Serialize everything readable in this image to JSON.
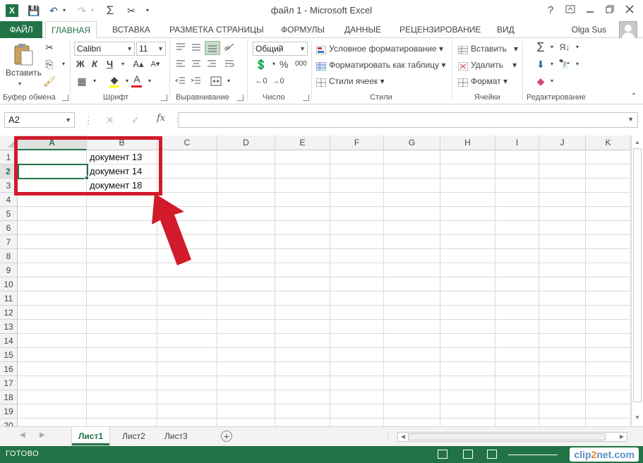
{
  "title_bar": {
    "app_badge": "X",
    "title": "файл 1 - Microsoft Excel",
    "help": "?",
    "qat": {
      "save": "💾",
      "undo": "↶",
      "redo": "↷",
      "autosum": "Σ",
      "cut": "✂"
    }
  },
  "tabs": {
    "file": "ФАЙЛ",
    "items": [
      "ГЛАВНАЯ",
      "ВСТАВКА",
      "РАЗМЕТКА СТРАНИЦЫ",
      "ФОРМУЛЫ",
      "ДАННЫЕ",
      "РЕЦЕНЗИРОВАНИЕ",
      "ВИД"
    ],
    "active": "ГЛАВНАЯ",
    "user": "Olga Sus"
  },
  "ribbon": {
    "clipboard": {
      "paste": "Вставить",
      "label": "Буфер обмена"
    },
    "font": {
      "name": "Calibri",
      "size": "11",
      "bold": "Ж",
      "italic": "К",
      "underline": "Ч",
      "font_color_glyph": "А",
      "label": "Шрифт"
    },
    "alignment": {
      "label": "Выравнивание"
    },
    "number": {
      "format": "Общий",
      "percent": "%",
      "thousands": "000",
      "label": "Число"
    },
    "styles": {
      "conditional": "Условное форматирование",
      "as_table": "Форматировать как таблицу",
      "cell_styles": "Стили ячеек",
      "label": "Стили"
    },
    "cells": {
      "insert": "Вставить",
      "delete": "Удалить",
      "format": "Формат",
      "label": "Ячейки"
    },
    "editing": {
      "label": "Редактирование"
    }
  },
  "formula_bar": {
    "name_box": "A2",
    "fx": "fx",
    "value": ""
  },
  "grid": {
    "columns": [
      "A",
      "B",
      "C",
      "D",
      "E",
      "F",
      "G",
      "H",
      "I",
      "J",
      "K"
    ],
    "rows": [
      "1",
      "2",
      "3",
      "4",
      "5",
      "6",
      "7",
      "8",
      "9",
      "10",
      "11",
      "12",
      "13",
      "14",
      "15",
      "16",
      "17",
      "18",
      "19",
      "20"
    ],
    "selected_cell": "A2",
    "cells": {
      "B1": "документ 13",
      "B2": "документ 14",
      "B3": "документ 18"
    }
  },
  "sheets": {
    "tabs": [
      "Лист1",
      "Лист2",
      "Лист3"
    ],
    "active": "Лист1"
  },
  "status": {
    "text": "ГОТОВО",
    "watermark_a": "clip",
    "watermark_b": "2",
    "watermark_c": "net.com"
  },
  "colors": {
    "accent": "#217346",
    "highlight": "#d11a2a"
  }
}
